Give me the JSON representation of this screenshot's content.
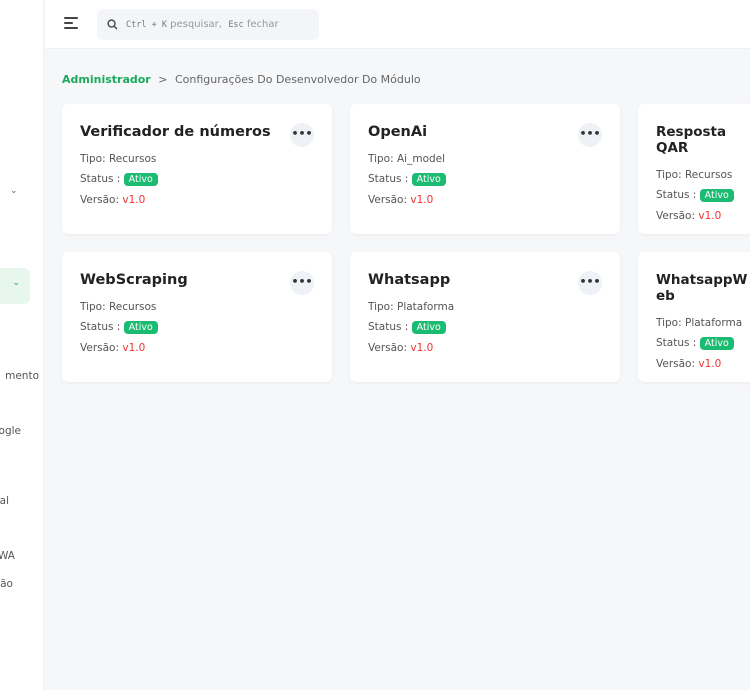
{
  "sidebar": {
    "items": [
      "mento",
      "oogle",
      "ial",
      "WA",
      "são"
    ]
  },
  "search": {
    "placeholder_key1": "Ctrl + K",
    "placeholder_text1": "pesquisar,",
    "placeholder_key2": "Esc",
    "placeholder_text2": "fechar"
  },
  "breadcrumb": {
    "root": "Administrador",
    "sep": ">",
    "current": "Configurações Do Desenvolvedor Do Módulo"
  },
  "labels": {
    "tipo": "Tipo: ",
    "status": "Status : ",
    "versao": "Versão: "
  },
  "cards": [
    {
      "title": "Verificador de números",
      "tipo": "Recursos",
      "status": "Ativo",
      "versao": "v1.0"
    },
    {
      "title": "OpenAi",
      "tipo": "Ai_model",
      "status": "Ativo",
      "versao": "v1.0"
    },
    {
      "title": "Resposta QAR",
      "tipo": "Recursos",
      "status": "Ativo",
      "versao": "v1.0"
    },
    {
      "title": "WebScraping",
      "tipo": "Recursos",
      "status": "Ativo",
      "versao": "v1.0"
    },
    {
      "title": "Whatsapp",
      "tipo": "Plataforma",
      "status": "Ativo",
      "versao": "v1.0"
    },
    {
      "title": "WhatsappWeb",
      "tipo": "Plataforma",
      "status": "Ativo",
      "versao": "v1.0"
    }
  ],
  "colors": {
    "accent": "#1aaa5a",
    "badge": "#1cbb72",
    "version": "#ee3333"
  },
  "menu_glyph": "•••"
}
